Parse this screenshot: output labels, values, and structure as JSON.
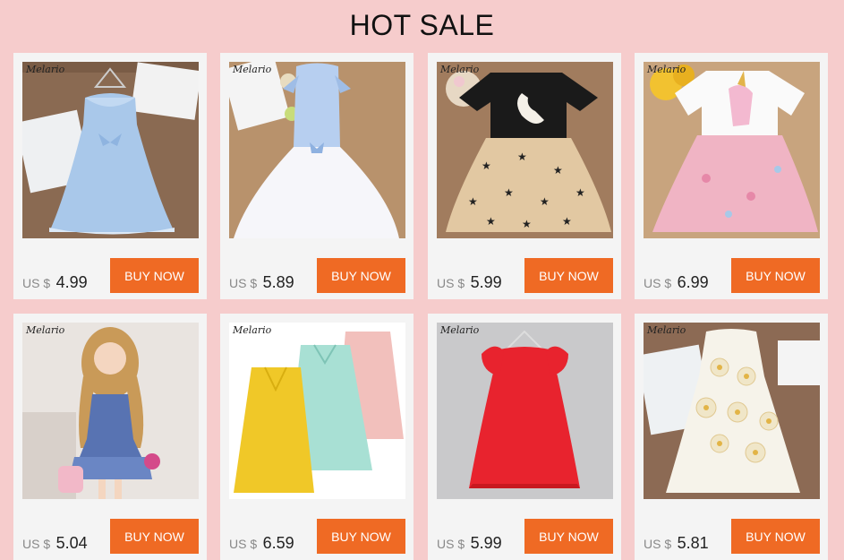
{
  "header": {
    "title": "HOT SALE"
  },
  "products": [
    {
      "brand": "Melario",
      "currency": "US $",
      "price": "4.99",
      "button": "BUY NOW",
      "image": "light-blue-eyelet-dress"
    },
    {
      "brand": "Melario",
      "currency": "US $",
      "price": "5.89",
      "button": "BUY NOW",
      "image": "blue-stripe-tulle-dress"
    },
    {
      "brand": "Melario",
      "currency": "US $",
      "price": "5.99",
      "button": "BUY NOW",
      "image": "swan-tee-star-tutu-set"
    },
    {
      "brand": "Melario",
      "currency": "US $",
      "price": "6.99",
      "button": "BUY NOW",
      "image": "unicorn-tee-pink-tutu-set"
    },
    {
      "brand": "Melario",
      "currency": "US $",
      "price": "5.04",
      "button": "BUY NOW",
      "image": "blue-plaid-tiered-dress"
    },
    {
      "brand": "Melario",
      "currency": "US $",
      "price": "6.59",
      "button": "BUY NOW",
      "image": "ruffle-lace-dresses-trio"
    },
    {
      "brand": "Melario",
      "currency": "US $",
      "price": "5.99",
      "button": "BUY NOW",
      "image": "red-eyelet-dress"
    },
    {
      "brand": "Melario",
      "currency": "US $",
      "price": "5.81",
      "button": "BUY NOW",
      "image": "white-daisy-dress"
    }
  ],
  "colors": {
    "background": "#f6cccc",
    "card": "#f4f4f4",
    "button": "#ef6a24"
  }
}
